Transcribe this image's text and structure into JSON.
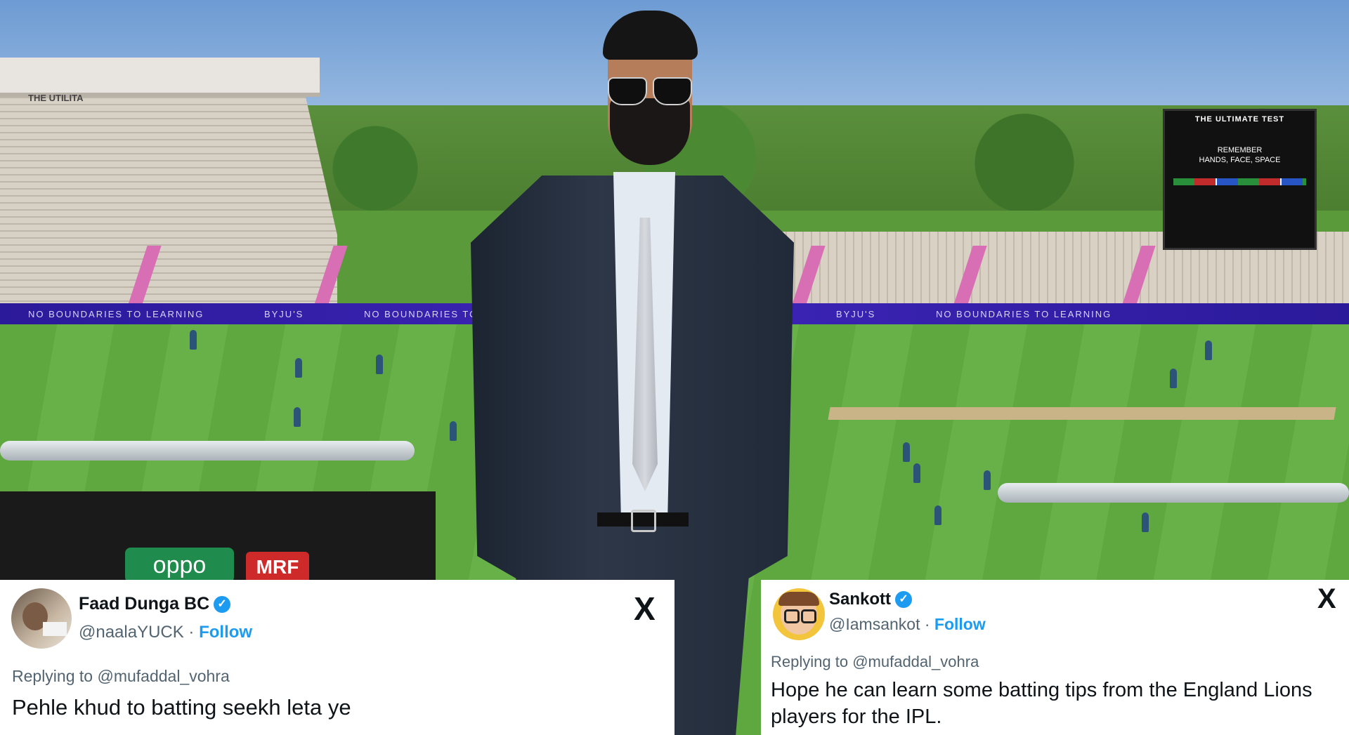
{
  "tweet_left": {
    "display_name": "Faad Dunga BC",
    "verified_mark": "✓",
    "handle": "@naalaYUCK",
    "separator": " · ",
    "follow_label": "Follow",
    "x_icon": "X",
    "replying_prefix": "Replying to",
    "replying_to": "@mufaddal_vohra",
    "text": "Pehle khud to batting seekh leta ye"
  },
  "tweet_right": {
    "display_name": "Sankott",
    "verified_mark": "✓",
    "handle": "@Iamsankot",
    "separator": " · ",
    "follow_label": "Follow",
    "x_icon": "X",
    "replying_prefix": "Replying to",
    "replying_to": "@mufaddal_vohra",
    "text": "Hope he can learn some batting tips from the England Lions players for the IPL."
  },
  "background_signage": {
    "boundary_board": "NO BOUNDARIES TO LEARNING",
    "boundary_sponsor": "BYJU'S",
    "stand_sign": "THE UTILITA",
    "scoreboard_title": "THE ULTIMATE TEST",
    "scoreboard_line1": "REMEMBER",
    "scoreboard_line2": "HANDS, FACE, SPACE",
    "ad_oppo": "oppo",
    "ad_mrf": "MRF"
  },
  "colors": {
    "verified_blue": "#1d9bf0",
    "follow_blue": "#1d9bf0",
    "board_purple": "#3d25b8"
  }
}
